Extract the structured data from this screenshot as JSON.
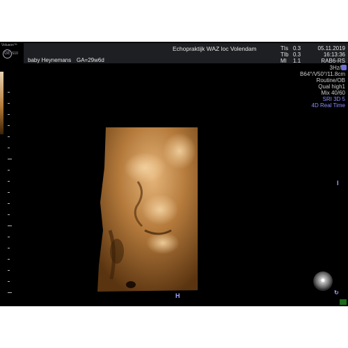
{
  "logo": {
    "brand": "Voluson™",
    "mark": "GE",
    "model": "S10"
  },
  "header": {
    "facility": "Echopraktijk WAZ loc Volendam",
    "patient": "baby Heynemans",
    "ga": "GA=29w6d",
    "tis_label": "TIs",
    "tis_value": "0.3",
    "tib_label": "TIb",
    "tib_value": "0.3",
    "mi_label": "MI",
    "mi_value": "1.1",
    "date": "05.11.2019",
    "time": "16:13:36",
    "probe": "RAB6-RS"
  },
  "params": {
    "frame_rate": "3Hz/",
    "angles": "B64°/V50°/11.8cm",
    "preset": "Routine/OB",
    "quality": "Qual high1",
    "mix": "Mix 40/60",
    "sri": "SRI 3D 5",
    "mode": "4D Real Time"
  },
  "icons": {
    "cursor_right": "I",
    "cursor_bottom": "H"
  },
  "colors": {
    "background": "#000000",
    "header": "#1d1f22",
    "accent": "#8a8cff",
    "render": "#b57b39"
  }
}
